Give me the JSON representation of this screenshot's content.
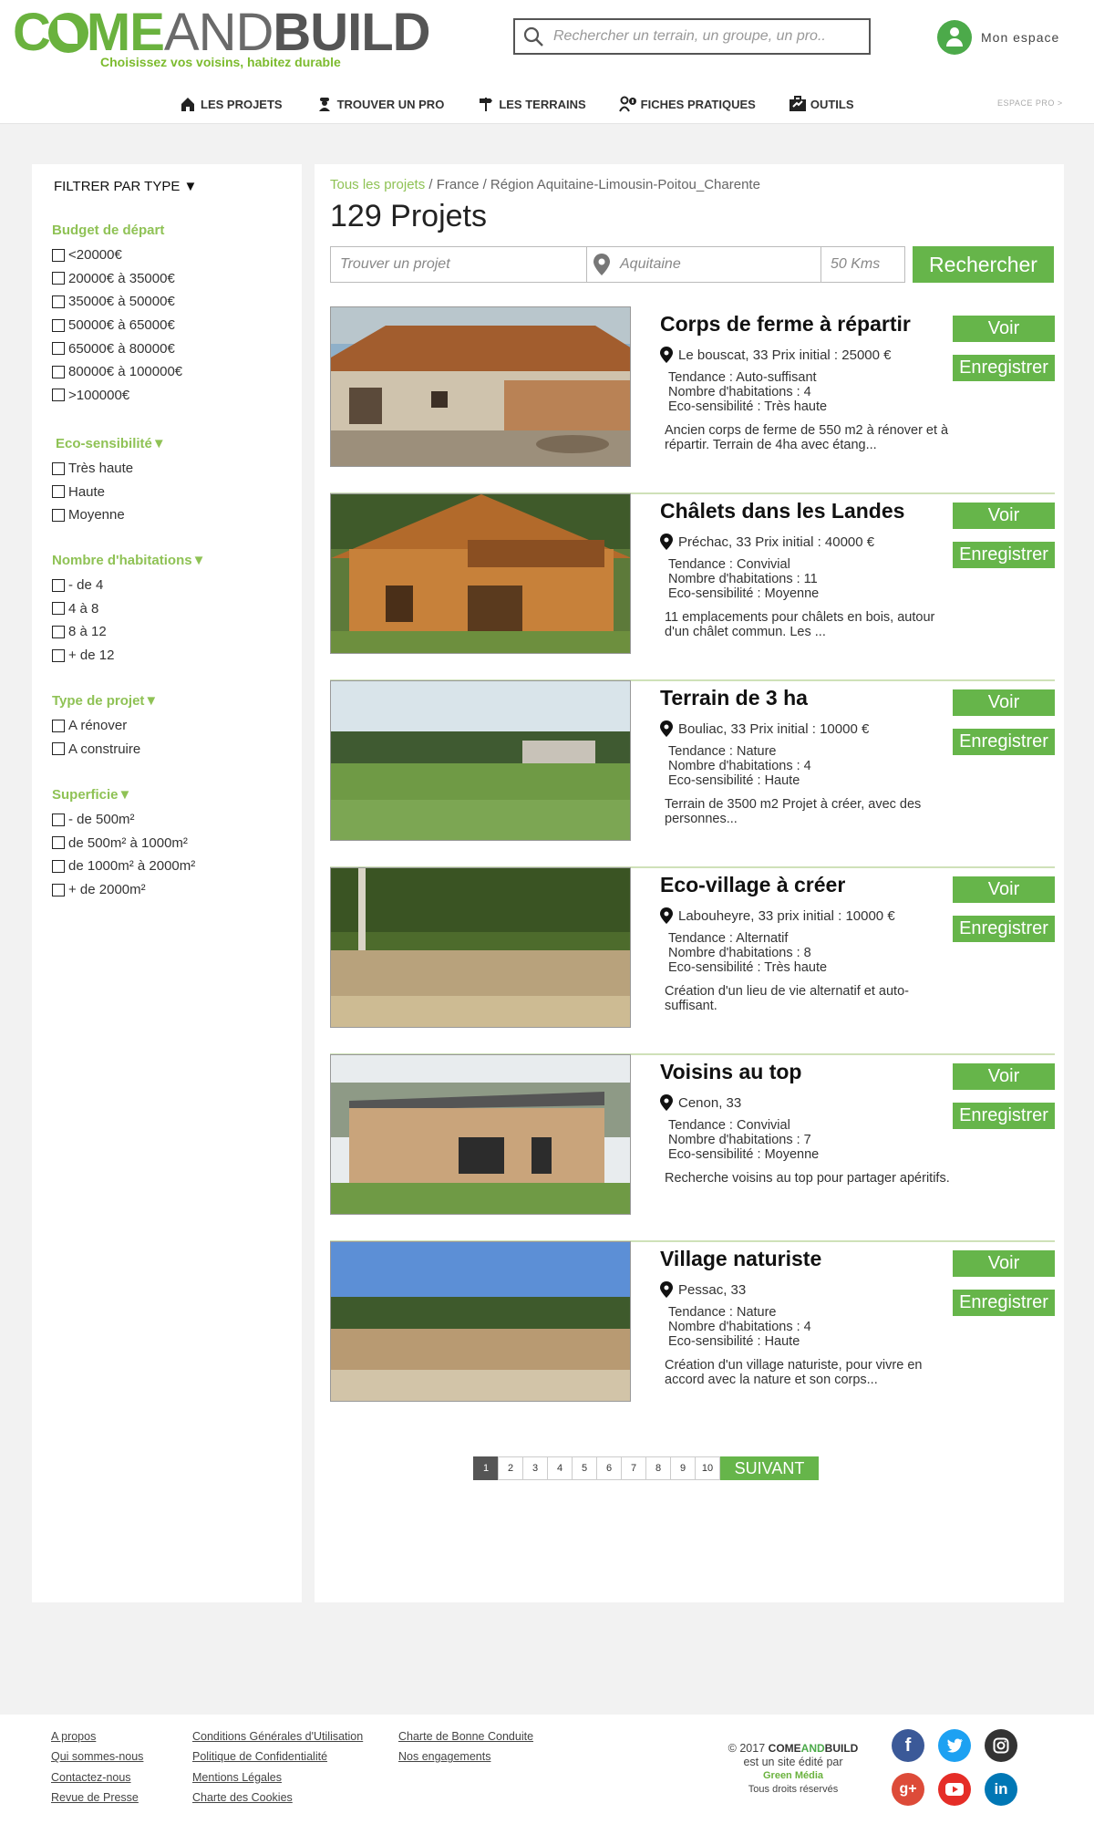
{
  "header": {
    "logo": {
      "part1": "C",
      "part2": "ME",
      "part3": "AND",
      "part4": "BUILD"
    },
    "tagline": "Choisissez vos voisins, habitez durable",
    "search_placeholder": "Rechercher un terrain, un groupe, un pro..",
    "account_label": "Mon espace",
    "espace_pro": "ESPACE PRO >"
  },
  "nav": [
    {
      "label": "LES PROJETS",
      "icon": "house-icon"
    },
    {
      "label": "TROUVER UN PRO",
      "icon": "worker-icon"
    },
    {
      "label": "LES TERRAINS",
      "icon": "signpost-icon"
    },
    {
      "label": "FICHES PRATIQUES",
      "icon": "info-person-icon"
    },
    {
      "label": "OUTILS",
      "icon": "toolbox-icon"
    }
  ],
  "sidebar": {
    "title": "FILTRER PAR TYPE ▼",
    "groups": [
      {
        "heading": "Budget de départ",
        "options": [
          "<20000€",
          "20000€ à 35000€",
          "35000€ à 50000€",
          "50000€ à 65000€",
          "65000€ à 80000€",
          "80000€ à 100000€",
          ">100000€"
        ]
      },
      {
        "heading": "Eco-sensibilité▼",
        "options": [
          "Très haute",
          "Haute",
          "Moyenne"
        ]
      },
      {
        "heading": "Nombre d'habitations▼",
        "options": [
          "- de 4",
          "4 à 8",
          "8 à 12",
          "+ de 12"
        ]
      },
      {
        "heading": "Type de projet▼",
        "options": [
          "A rénover",
          "A construire"
        ]
      },
      {
        "heading": "Superficie▼",
        "options": [
          "- de 500m²",
          "de 500m² à 1000m²",
          "de 1000m² à 2000m²",
          "+ de 2000m²"
        ]
      }
    ]
  },
  "main": {
    "breadcrumb": {
      "root": "Tous les projets",
      "rest": " / France / Région Aquitaine-Limousin-Poitou_Charente"
    },
    "count": "129 Projets",
    "search": {
      "project_placeholder": "Trouver un projet",
      "location": "Aquitaine",
      "distance": "50 Kms",
      "button": "Rechercher"
    },
    "buttons": {
      "view": "Voir",
      "save": "Enregistrer"
    },
    "projects": [
      {
        "title": "Corps de ferme à répartir",
        "location": "Le bouscat, 33 Prix initial : 25000 €",
        "tendance": "Tendance : Auto-suffisant",
        "habitations": "Nombre d'habitations : 4",
        "eco": "Eco-sensibilité : Très haute",
        "desc": "Ancien corps de ferme de 550 m2 à rénover et à répartir. Terrain de 4ha avec étang..."
      },
      {
        "title": "Châlets dans les Landes",
        "location": "Préchac, 33 Prix initial : 40000 €",
        "tendance": "Tendance : Convivial",
        "habitations": "Nombre d'habitations : 11",
        "eco": "Eco-sensibilité : Moyenne",
        "desc": "11 emplacements pour châlets en bois, autour d'un châlet commun. Les ..."
      },
      {
        "title": "Terrain de 3 ha",
        "location": "Bouliac, 33 Prix initial : 10000 €",
        "tendance": "Tendance : Nature",
        "habitations": "Nombre d'habitations : 4",
        "eco": "Eco-sensibilité : Haute",
        "desc": "Terrain de 3500 m2 Projet à créer, avec des personnes..."
      },
      {
        "title": "Eco-village à créer",
        "location": "Labouheyre, 33 prix initial : 10000 €",
        "tendance": "Tendance : Alternatif",
        "habitations": "Nombre d'habitations : 8",
        "eco": "Eco-sensibilité : Très haute",
        "desc": "Création d'un lieu de vie alternatif et auto-suffisant."
      },
      {
        "title": "Voisins au top",
        "location": "Cenon, 33",
        "tendance": "Tendance : Convivial",
        "habitations": "Nombre d'habitations : 7",
        "eco": "Eco-sensibilité : Moyenne",
        "desc": "Recherche voisins au top pour partager apéritifs."
      },
      {
        "title": "Village naturiste",
        "location": "Pessac, 33",
        "tendance": "Tendance : Nature",
        "habitations": "Nombre d'habitations : 4",
        "eco": "Eco-sensibilité : Haute",
        "desc": "Création d'un village naturiste, pour vivre en accord avec la nature et son corps..."
      }
    ],
    "pagination": {
      "pages": [
        "1",
        "2",
        "3",
        "4",
        "5",
        "6",
        "7",
        "8",
        "9",
        "10"
      ],
      "next": "SUIVANT"
    }
  },
  "footer": {
    "col1": [
      "A propos",
      "Qui sommes-nous",
      "Contactez-nous",
      "Revue de Presse"
    ],
    "col2": [
      "Conditions Générales d'Utilisation",
      "Politique de Confidentialité",
      "Mentions Légales",
      "Charte des Cookies"
    ],
    "col3": [
      "Charte de Bonne Conduite",
      "Nos engagements"
    ],
    "copyright": "© 2017",
    "brand_a": "COME",
    "brand_b": "AND",
    "brand_c": "BUILD",
    "edited": "est un site édité par",
    "editor": "Green Média",
    "rights": "Tous droits réservés",
    "social": [
      "facebook-icon",
      "twitter-icon",
      "instagram-icon",
      "google-plus-icon",
      "youtube-icon",
      "linkedin-icon"
    ]
  },
  "colors": {
    "accent": "#66b54a",
    "filter_heading": "#8fc255"
  }
}
